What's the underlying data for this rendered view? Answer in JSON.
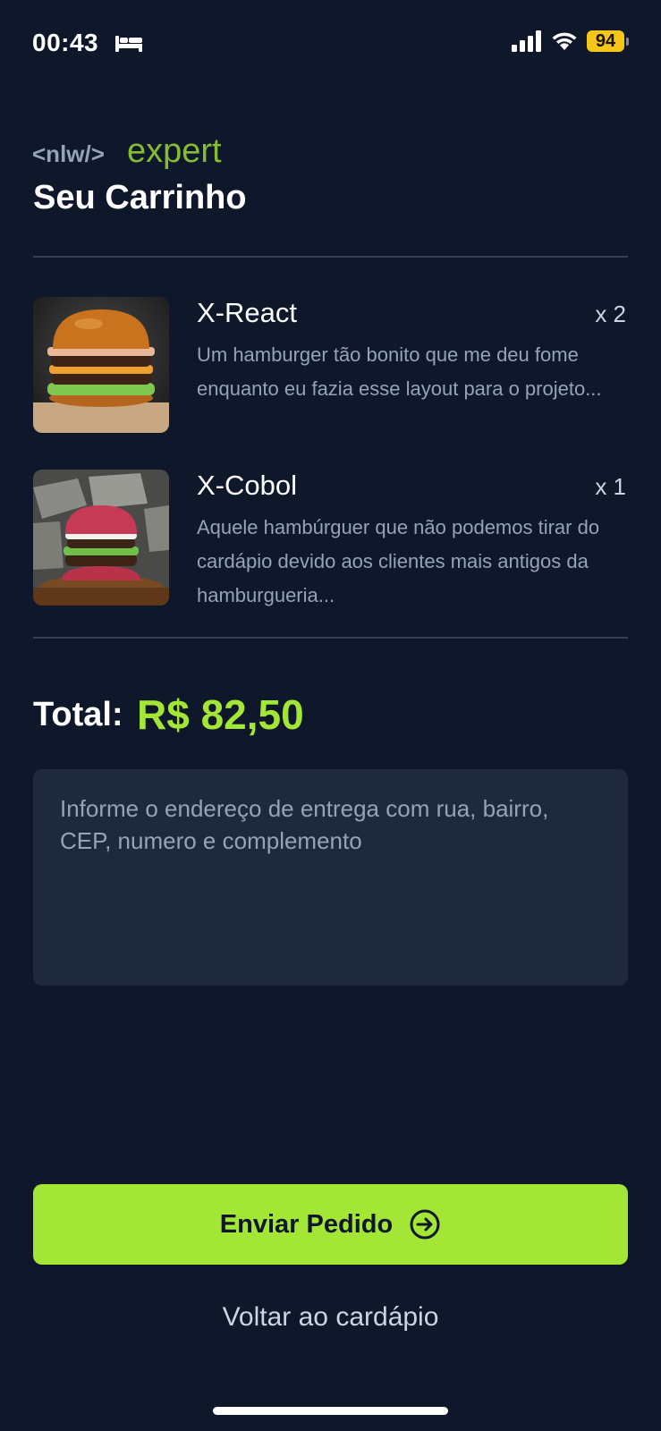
{
  "status_bar": {
    "time": "00:43",
    "battery": "94",
    "icons": [
      "bed-icon",
      "signal-icon",
      "wifi-icon",
      "battery-icon"
    ]
  },
  "header": {
    "logo_prefix": "<nlw/>",
    "logo_word": "expert",
    "title": "Seu Carrinho"
  },
  "cart": {
    "items": [
      {
        "name": "X-React",
        "quantity": "x 2",
        "description": "Um hamburger tão bonito que me deu fome enquanto eu fazia esse layout para o projeto..."
      },
      {
        "name": "X-Cobol",
        "quantity": "x 1",
        "description": "Aquele hambúrguer que não podemos tirar do cardápio devido aos clientes mais antigos da hamburgueria..."
      }
    ]
  },
  "total": {
    "label": "Total:",
    "value": "R$ 82,50"
  },
  "address": {
    "placeholder": "Informe o endereço de entrega com rua, bairro, CEP, numero e complemento",
    "value": ""
  },
  "actions": {
    "send_label": "Enviar Pedido",
    "back_label": "Voltar ao cardápio"
  },
  "colors": {
    "background": "#0f172a",
    "accent": "#a3e635",
    "input_bg": "#1e293b",
    "muted_text": "#94a3b8"
  }
}
